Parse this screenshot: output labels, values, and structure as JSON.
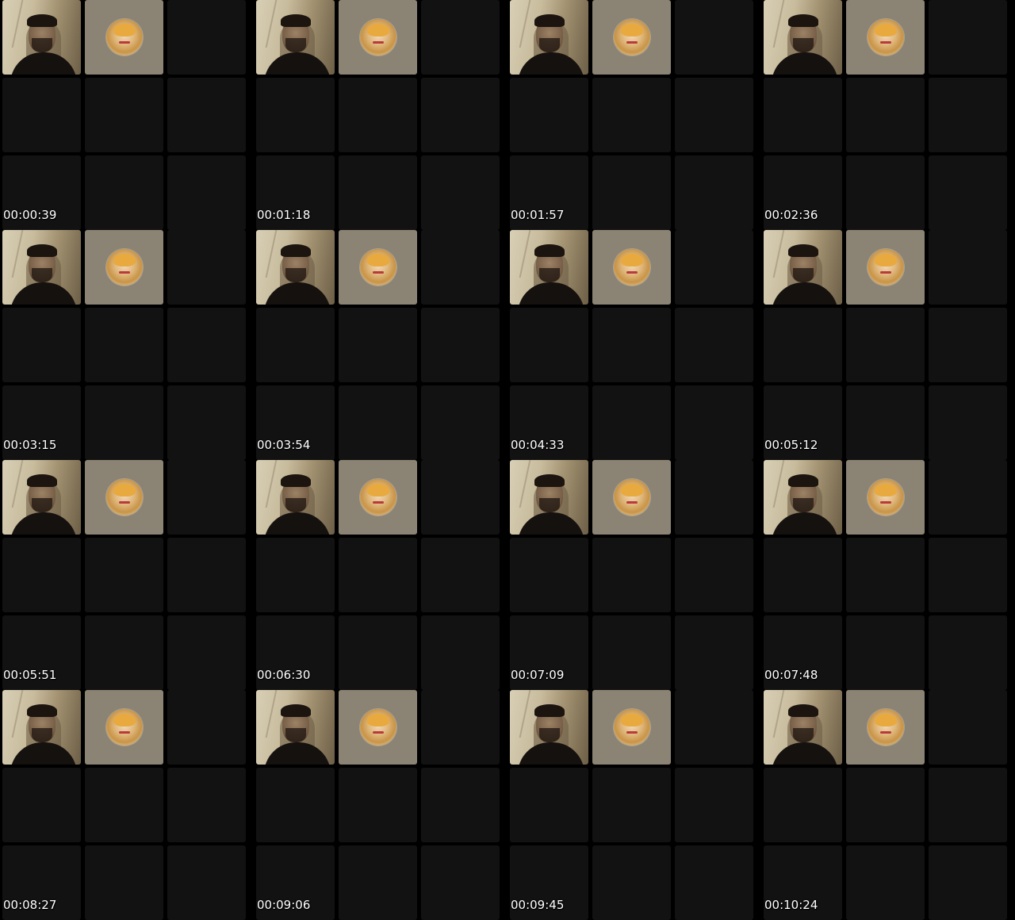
{
  "thumbnails": [
    {
      "timestamp": "00:00:39"
    },
    {
      "timestamp": "00:01:18"
    },
    {
      "timestamp": "00:01:57"
    },
    {
      "timestamp": "00:02:36"
    },
    {
      "timestamp": "00:03:15"
    },
    {
      "timestamp": "00:03:54"
    },
    {
      "timestamp": "00:04:33"
    },
    {
      "timestamp": "00:05:12"
    },
    {
      "timestamp": "00:05:51"
    },
    {
      "timestamp": "00:06:30"
    },
    {
      "timestamp": "00:07:09"
    },
    {
      "timestamp": "00:07:48"
    },
    {
      "timestamp": "00:08:27"
    },
    {
      "timestamp": "00:09:06"
    },
    {
      "timestamp": "00:09:45"
    },
    {
      "timestamp": "00:10:24"
    }
  ],
  "colors": {
    "background": "#000000",
    "empty_tile": "#121212",
    "avatar_tile": "#8b8373",
    "timestamp_text": "#ffffff"
  },
  "icons": {
    "participant_video": "participant-video-icon",
    "participant_avatar": "participant-avatar-icon"
  }
}
